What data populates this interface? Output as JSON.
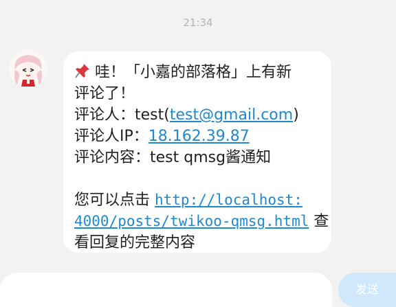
{
  "status": {
    "time": "21:34"
  },
  "message": {
    "line1": "哇！「小嘉的部落格」上有新",
    "line2": "评论了！",
    "commenter_prefix": "评论人：test(",
    "commenter_email": "test@gmail.com",
    "commenter_suffix": ")",
    "ip_prefix": "评论人IP：",
    "ip_value": "18.162.39.87",
    "content_prefix": "评论内容：test qmsg酱通知",
    "view_prefix": "您可以点击 ",
    "link_part1": "http://localhost:",
    "link_part2": "4000/posts/twikoo-qmsg.html",
    "view_suffix": " 查",
    "view_line3": "看回复的完整内容"
  },
  "composer": {
    "send_label": "发送"
  },
  "icons": {
    "pin": "pushpin-icon",
    "avatar": "anime-avatar"
  },
  "colors": {
    "link": "#1e88d0",
    "send_bg": "#cfe8fb",
    "background": "#f2f2f2"
  }
}
